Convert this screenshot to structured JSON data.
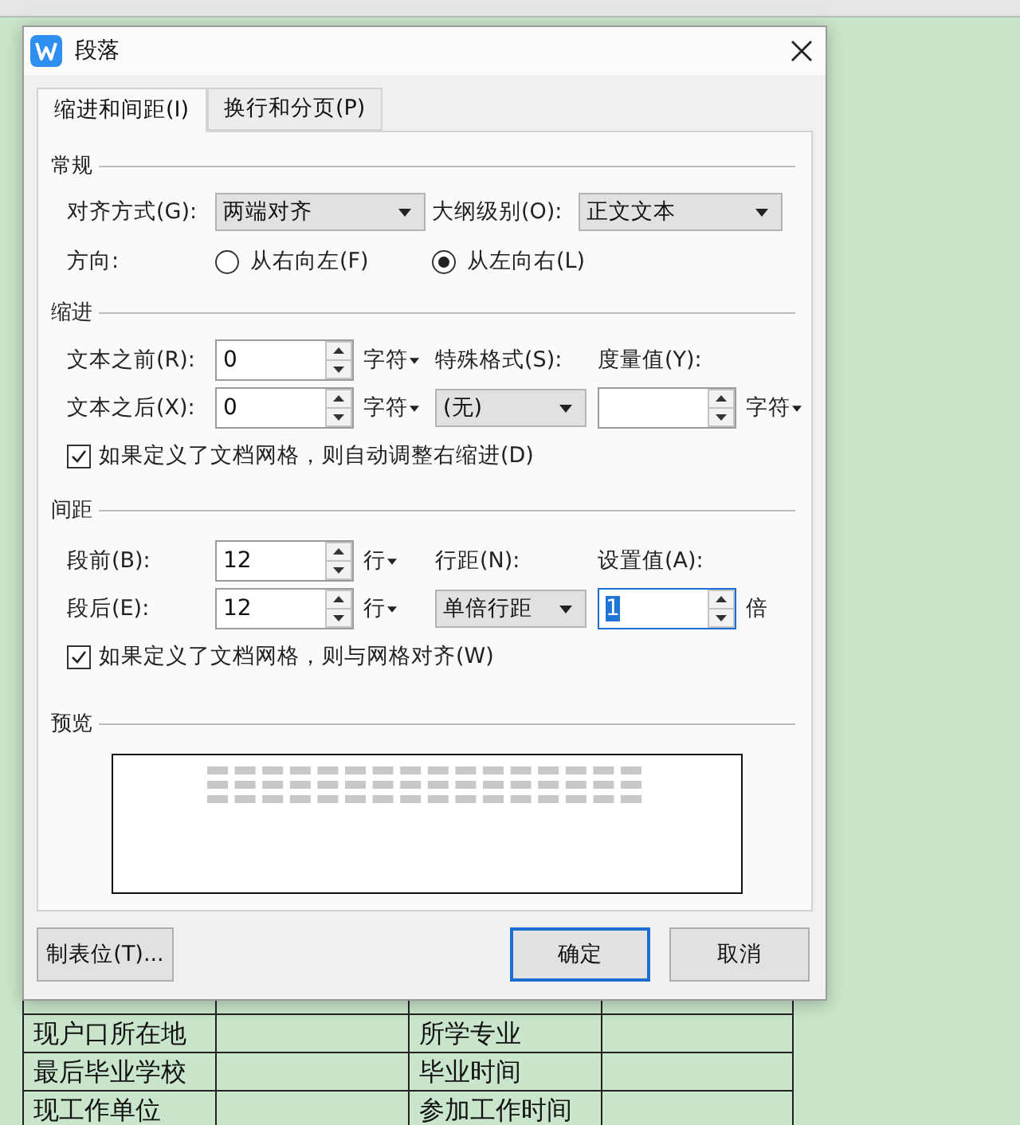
{
  "window": {
    "title": "段落"
  },
  "tabs": [
    {
      "label": "缩进和间距(I)",
      "selected": true
    },
    {
      "label": "换行和分页(P)",
      "selected": false
    }
  ],
  "general": {
    "heading": "常规",
    "alignment": {
      "label": "对齐方式(G):",
      "value": "两端对齐"
    },
    "outline_level": {
      "label": "大纲级别(O):",
      "value": "正文文本"
    },
    "direction": {
      "label": "方向:",
      "options": [
        {
          "label": "从右向左(F)",
          "selected": false
        },
        {
          "label": "从左向右(L)",
          "selected": true
        }
      ]
    }
  },
  "indent": {
    "heading": "缩进",
    "before": {
      "label": "文本之前(R):",
      "value": "0",
      "unit": "字符"
    },
    "after": {
      "label": "文本之后(X):",
      "value": "0",
      "unit": "字符"
    },
    "special": {
      "label": "特殊格式(S):",
      "value": "(无)"
    },
    "measure": {
      "label": "度量值(Y):",
      "unit": "字符"
    },
    "auto_adjust": {
      "label": "如果定义了文档网格，则自动调整右缩进(D)",
      "checked": true
    }
  },
  "spacing": {
    "heading": "间距",
    "before": {
      "label": "段前(B):",
      "value": "12",
      "unit": "行"
    },
    "after": {
      "label": "段后(E):",
      "value": "12",
      "unit": "行"
    },
    "line_spacing": {
      "label": "行距(N):",
      "value": "单倍行距"
    },
    "set_value": {
      "label": "设置值(A):",
      "value": "1",
      "unit": "倍",
      "focused": true
    },
    "snap_to_grid": {
      "label": "如果定义了文档网格，则与网格对齐(W)",
      "checked": true
    }
  },
  "preview": {
    "heading": "预览"
  },
  "buttons": [
    {
      "label": "制表位(T)...",
      "default": false
    },
    {
      "label": "确定",
      "default": true
    },
    {
      "label": "取消",
      "default": false
    }
  ],
  "document": {
    "table_rows": [
      {
        "label_1": "现户口所在地",
        "label_2": "所学专业"
      },
      {
        "label_1": "最后毕业学校",
        "label_2": "毕业时间"
      },
      {
        "label_1": "现工作单位",
        "label_2": "参加工作时间"
      }
    ]
  }
}
